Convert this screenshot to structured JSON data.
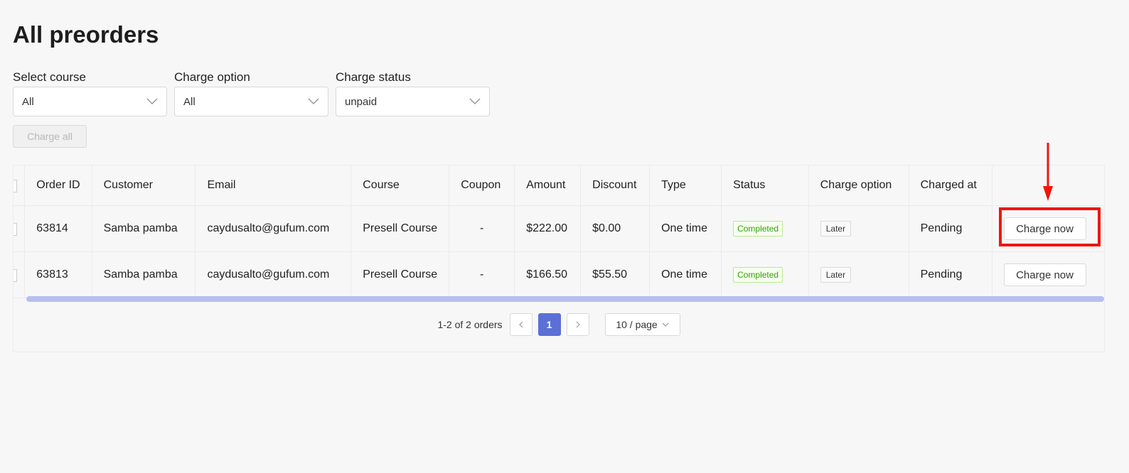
{
  "page": {
    "title": "All preorders"
  },
  "filters": [
    {
      "label": "Select course",
      "value": "All"
    },
    {
      "label": "Charge option",
      "value": "All"
    },
    {
      "label": "Charge status",
      "value": "unpaid"
    }
  ],
  "actions": {
    "charge_all_label": "Charge all"
  },
  "table": {
    "columns": [
      "Order ID",
      "Customer",
      "Email",
      "Course",
      "Coupon",
      "Amount",
      "Discount",
      "Type",
      "Status",
      "Charge option",
      "Charged at"
    ],
    "rows": [
      {
        "order_id": "63814",
        "customer": "Samba pamba",
        "email": "caydusalto@gufum.com",
        "course": "Presell Course",
        "coupon": "-",
        "amount": "$222.00",
        "discount": "$0.00",
        "type": "One time",
        "status": "Completed",
        "charge_option": "Later",
        "charged_at": "Pending",
        "action_label": "Charge now"
      },
      {
        "order_id": "63813",
        "customer": "Samba pamba",
        "email": "caydusalto@gufum.com",
        "course": "Presell Course",
        "coupon": "-",
        "amount": "$166.50",
        "discount": "$55.50",
        "type": "One time",
        "status": "Completed",
        "charge_option": "Later",
        "charged_at": "Pending",
        "action_label": "Charge now"
      }
    ]
  },
  "pagination": {
    "total_text": "1-2 of 2 orders",
    "current_page": "1",
    "page_size": "10 / page"
  },
  "icons": {
    "prev": "chevron-left-icon",
    "next": "chevron-right-icon",
    "dropdown": "chevron-down-icon",
    "annotation": "arrow-down-icon"
  },
  "colors": {
    "accent": "#5b6fd6",
    "scrollbar": "#b6bff0",
    "annotation": "#f2140f",
    "status_green": "#389e0d"
  }
}
